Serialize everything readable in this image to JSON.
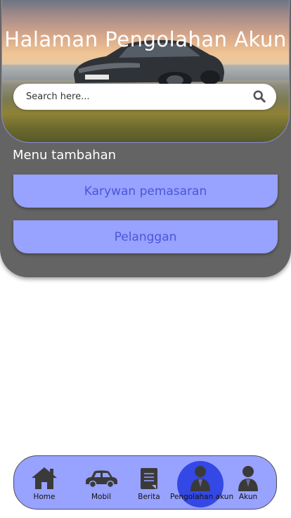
{
  "header": {
    "title": "Halaman Pengolahan Akun"
  },
  "search": {
    "placeholder": "Search here..."
  },
  "menu": {
    "title": "Menu tambahan",
    "items": [
      {
        "label": "Karywan pemasaran"
      },
      {
        "label": "Pelanggan"
      }
    ]
  },
  "bottom_nav": {
    "active_index": 3,
    "items": [
      {
        "label": "Home",
        "icon": "home-icon"
      },
      {
        "label": "Mobil",
        "icon": "car-icon"
      },
      {
        "label": "Berita",
        "icon": "news-icon"
      },
      {
        "label": "Pengolahan akun",
        "icon": "person-icon"
      },
      {
        "label": "Akun",
        "icon": "account-icon"
      }
    ]
  },
  "colors": {
    "card_bg": "#646464",
    "button_bg": "#98a2ff",
    "button_text": "#4a57d8",
    "nav_bg": "#98a2ff",
    "active": "#3448e6"
  }
}
